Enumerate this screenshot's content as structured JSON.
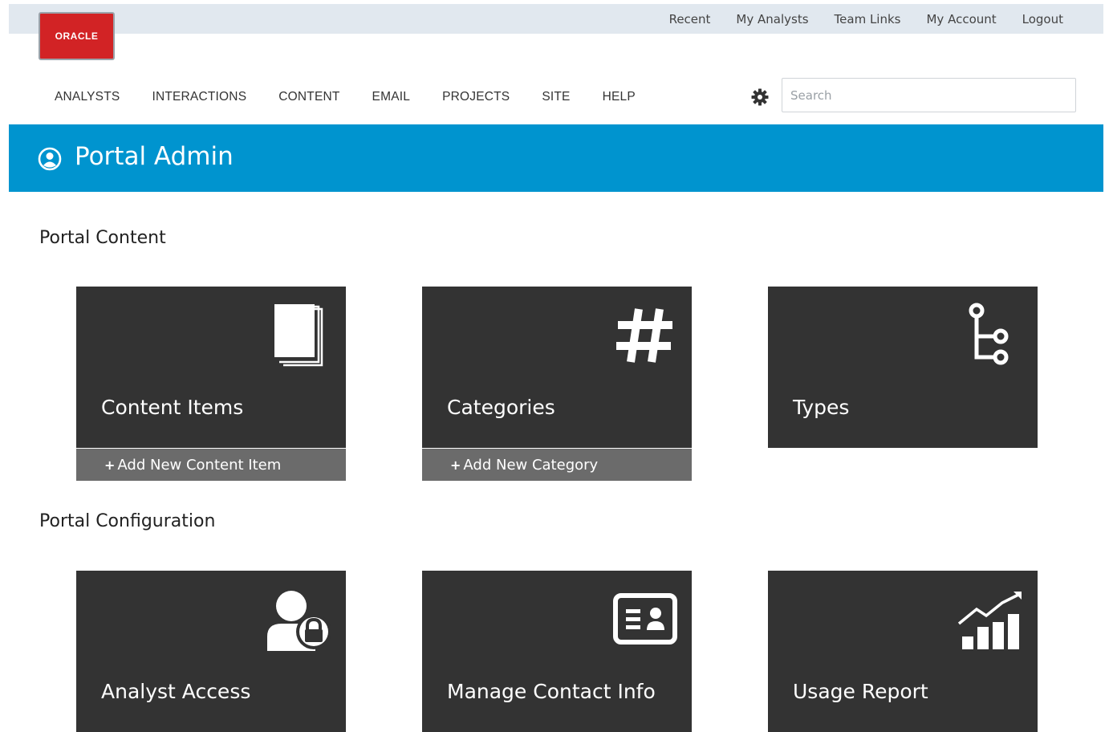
{
  "header": {
    "logo_text": "ORACLE",
    "top_links": [
      "Recent",
      "My Analysts",
      "Team Links",
      "My Account",
      "Logout"
    ],
    "nav": [
      "ANALYSTS",
      "INTERACTIONS",
      "CONTENT",
      "EMAIL",
      "PROJECTS",
      "SITE",
      "HELP"
    ],
    "search_placeholder": "Search"
  },
  "banner": {
    "title": "Portal Admin",
    "icon": "user-circle-icon"
  },
  "sections": {
    "content_title": "Portal Content",
    "config_title": "Portal Configuration"
  },
  "tiles": {
    "content_items": {
      "label": "Content Items",
      "icon": "documents-icon",
      "action": "Add New Content Item"
    },
    "categories": {
      "label": "Categories",
      "icon": "hash-icon",
      "action": "Add New Category"
    },
    "types": {
      "label": "Types",
      "icon": "tree-icon"
    },
    "analyst_access": {
      "label": "Analyst Access",
      "icon": "user-lock-icon"
    },
    "manage_contact_info": {
      "label": "Manage Contact Info",
      "icon": "contact-card-icon"
    },
    "usage_report": {
      "label": "Usage Report",
      "icon": "chart-up-icon"
    }
  },
  "colors": {
    "banner": "#0094cf",
    "tile": "#333333",
    "tile_footer": "#6b6b6b",
    "logo": "#d22325",
    "topbar": "#e1e8ef"
  }
}
